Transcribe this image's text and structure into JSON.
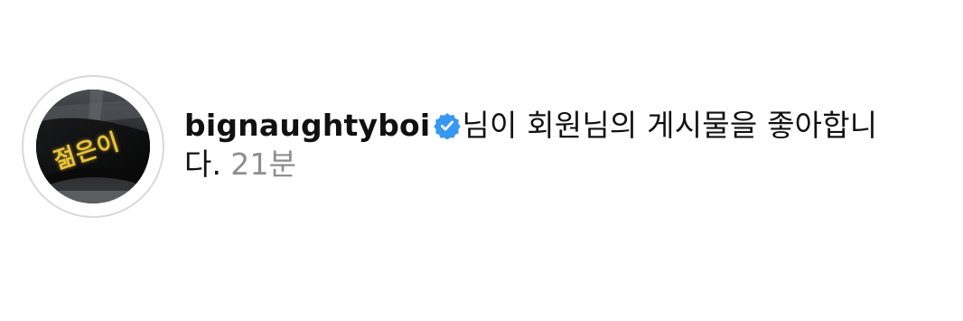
{
  "notification": {
    "username": "bignaughtyboi",
    "verified": true,
    "badge_color": "#3897f0",
    "icon": "verified-badge-icon",
    "message": "님이 회원님의 게시물을 좋아합니다.",
    "timestamp": "21분"
  },
  "avatar": {
    "icon": "profile-avatar",
    "sign_text": "젊은이",
    "sign_color": "#e8c23a"
  }
}
